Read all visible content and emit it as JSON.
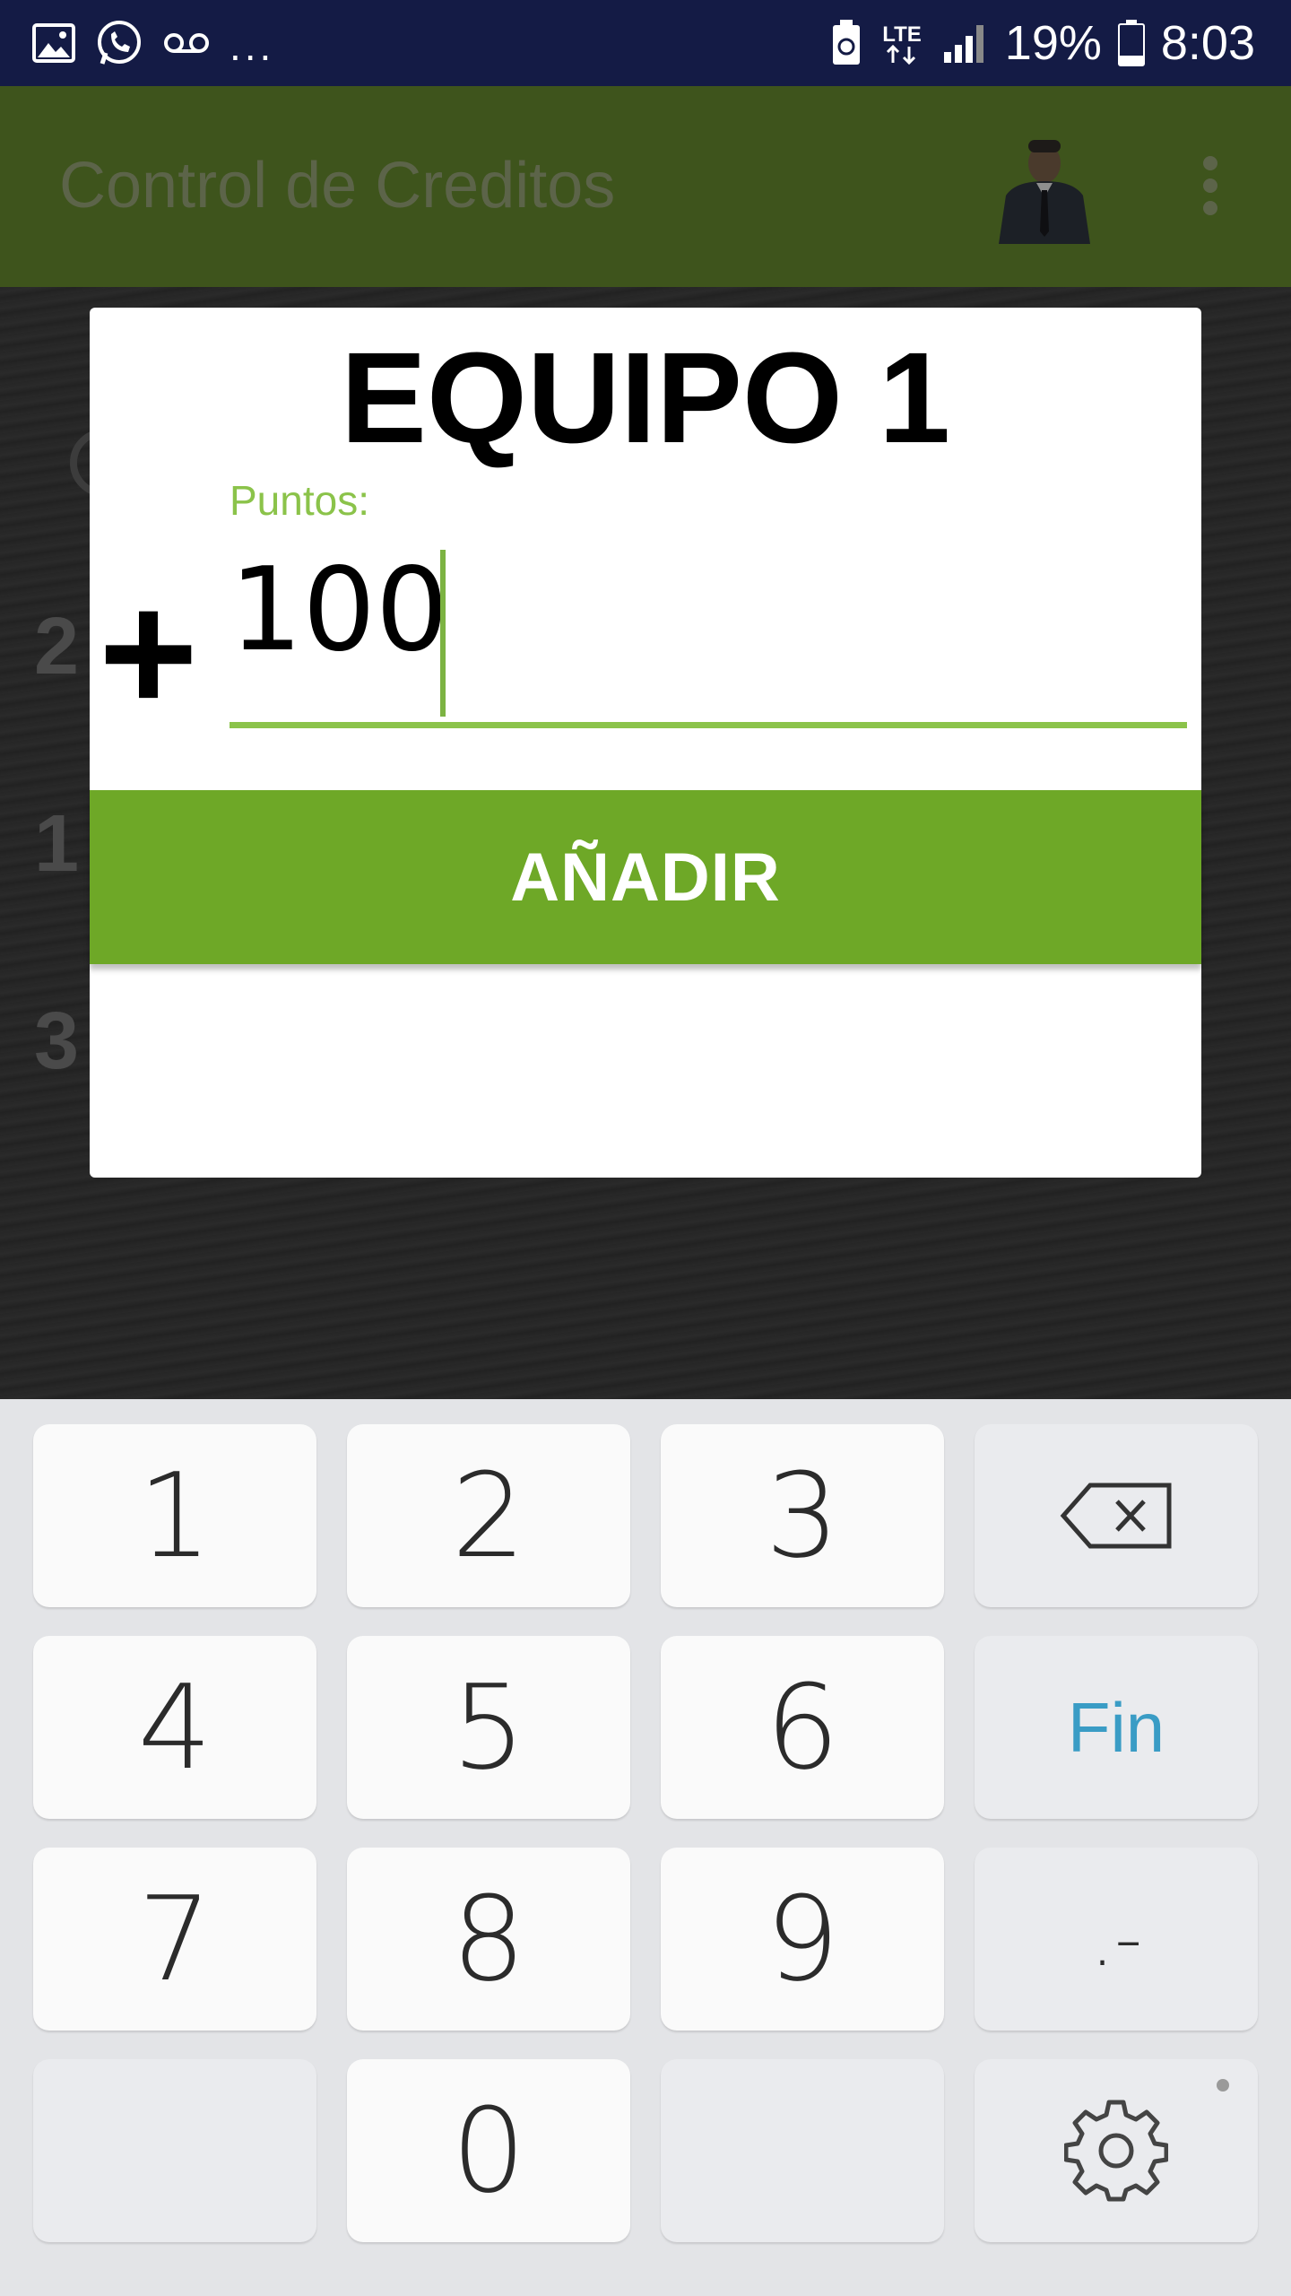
{
  "status_bar": {
    "icons": [
      "image-icon",
      "whatsapp-icon",
      "voicemail-icon"
    ],
    "overflow": "...",
    "network": "LTE",
    "battery": "19%",
    "time": "8:03"
  },
  "app_bar": {
    "title": "Control de Creditos"
  },
  "background": {
    "digits": [
      "2",
      "1",
      "3"
    ]
  },
  "dialog": {
    "title": "EQUIPO 1",
    "field_label": "Puntos:",
    "sign": "+",
    "field_value": "100",
    "add_button": "AÑADIR"
  },
  "keyboard": {
    "keys": [
      "1",
      "2",
      "3",
      "4",
      "5",
      "6",
      "7",
      "8",
      "9",
      "0"
    ],
    "fin_label": "Fin",
    "dot_dash_label": ".-"
  },
  "colors": {
    "status_bar_bg": "#141b45",
    "app_bar_bg": "#3e541c",
    "accent_green": "#8bc34a",
    "button_green": "#6ea827",
    "fin_blue": "#3a9cc5",
    "keyboard_bg": "#e3e4e7"
  }
}
